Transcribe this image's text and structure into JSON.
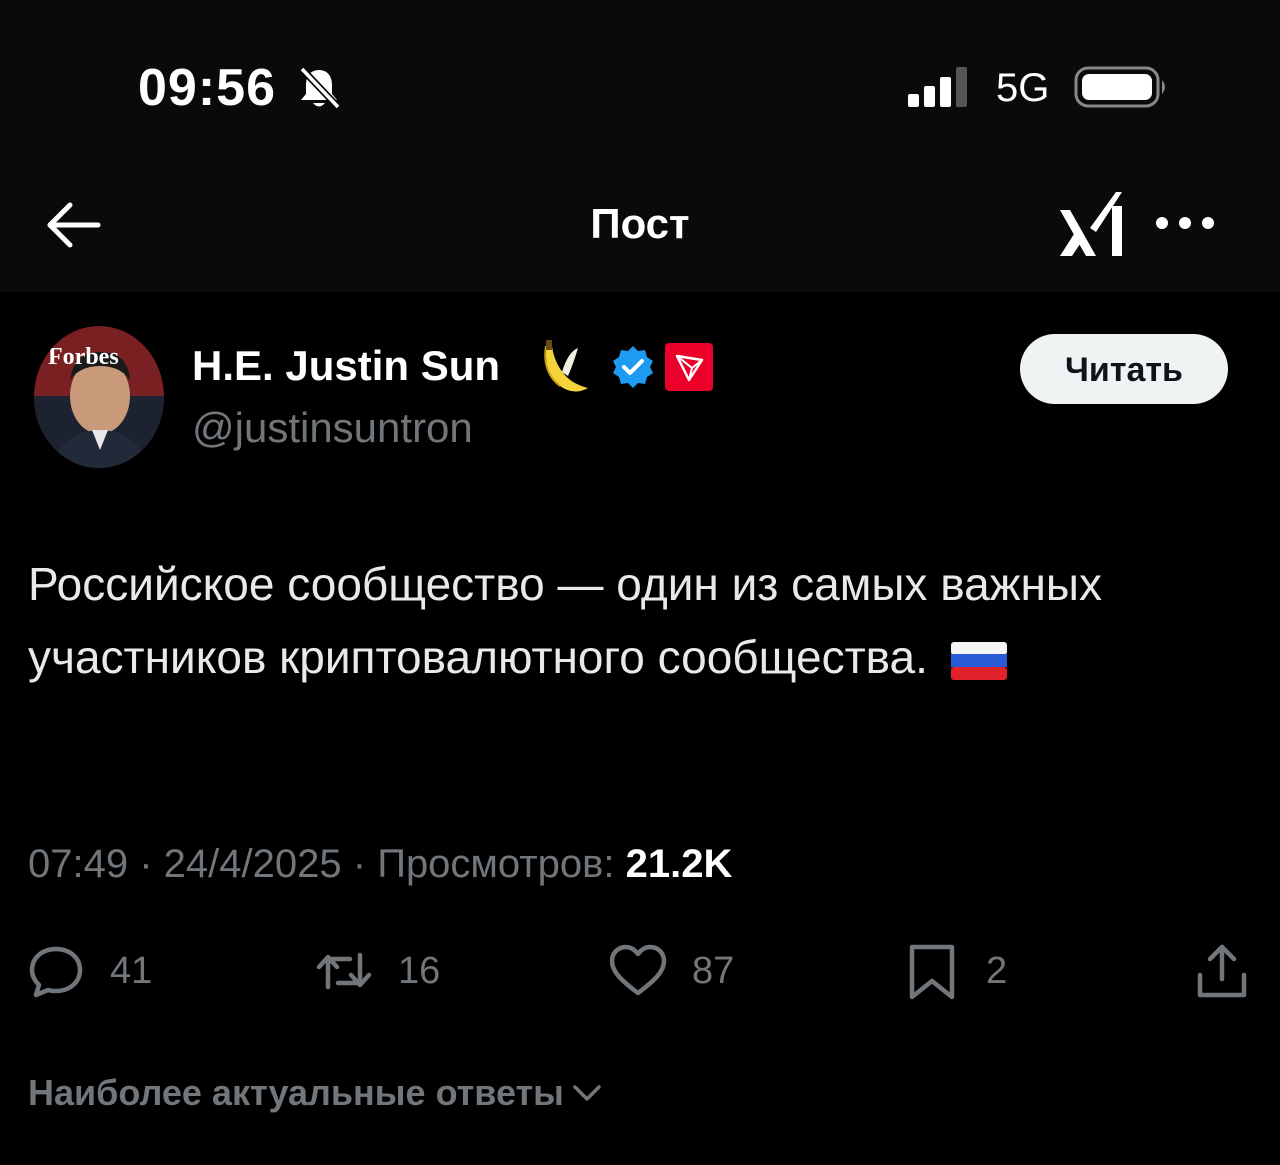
{
  "status_bar": {
    "time": "09:56",
    "network": "5G"
  },
  "nav": {
    "title": "Пост"
  },
  "tweet": {
    "author_name": "H.E. Justin Sun",
    "author_handle": "@justinsuntron",
    "avatar_text": "Forbes",
    "follow_label": "Читать",
    "text": "Российское сообщество — один из самых важных участников криптовалютного сообщества.",
    "time": "07:49",
    "date": "24/4/2025",
    "views_label": "Просмотров:",
    "views_count": "21.2K",
    "replies": "41",
    "retweets": "16",
    "likes": "87",
    "bookmarks": "2"
  },
  "replies_section": {
    "label": "Наиболее актуальные ответы"
  },
  "icons": {
    "back": "arrow-left-icon",
    "grok": "grok-icon",
    "more": "more-icon",
    "verified": "verified-badge-icon",
    "affiliate": "tron-badge-icon",
    "emoji": "banana-icon",
    "flag": "russia-flag-icon",
    "reply": "reply-icon",
    "retweet": "retweet-icon",
    "like": "heart-icon",
    "bookmark": "bookmark-icon",
    "share": "share-icon"
  },
  "colors": {
    "background": "#000000",
    "text": "#e7e9ea",
    "secondary": "#71767b",
    "verified": "#1d9bf0",
    "tron": "#eb0029"
  }
}
